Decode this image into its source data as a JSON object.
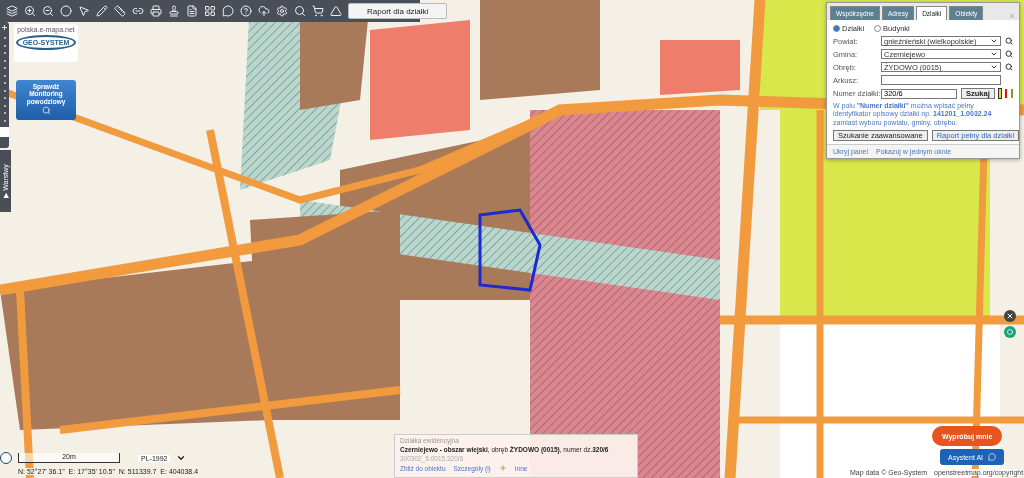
{
  "toolbar": {
    "report_button": "Raport dla działki"
  },
  "logo": {
    "site": "polska.e-mapa.net",
    "brand": "GEO-SYSTEM"
  },
  "flood_button": "Sprawdź Monitoring powodziowy",
  "zoom_slider": {
    "level": 0.1
  },
  "side_tab": {
    "icon": "▶",
    "label": "Warstwy"
  },
  "search_panel": {
    "tabs": [
      {
        "label": "Współrzędne",
        "selected": false
      },
      {
        "label": "Adresy",
        "selected": false
      },
      {
        "label": "Działki",
        "selected": true
      },
      {
        "label": "Obiekty",
        "selected": false
      }
    ],
    "radios": [
      {
        "label": "Działki",
        "selected": true
      },
      {
        "label": "Budynki",
        "selected": false
      }
    ],
    "fields": [
      {
        "label": "Powiat:",
        "kind": "select",
        "value": "gnieźnieński (wielkopolskie)"
      },
      {
        "label": "Gmina:",
        "kind": "select",
        "value": "Czerniejewo"
      },
      {
        "label": "Obręb:",
        "kind": "select",
        "value": "ŻYDOWO (0015)"
      },
      {
        "label": "Arkusz:",
        "kind": "text"
      }
    ],
    "number": {
      "label": "Numer działki:",
      "value": "320/6",
      "button": "Szukaj"
    },
    "swatches": [
      {
        "color": "#f2d21b",
        "selected": true
      },
      {
        "color": "#e01010",
        "selected": false
      },
      {
        "color": "#8a9a1a",
        "selected": false
      }
    ],
    "hint": "W polu **\"Numer działki\"** można wpisać pełny identyfikator opisowy działki np. **141201_1.0032.24** zamiast wyboru powiatu, gminy, obrębu.",
    "buttons": [
      "Szukanie zaawansowane",
      "Raport pełny dla działki"
    ],
    "footer_links": [
      "Ukryj panel",
      "Pokazuj w jednym oknie"
    ]
  },
  "info_popup": {
    "title": "Działka ewidencyjna",
    "description": "**Czerniejewo - obszar wiejski**, obręb **ŻYDOWO (0015)**, numer dz.**320/6**",
    "identifier": "300302_5.0015.320/6",
    "links": [
      "Zbliż do obiektu",
      "Szczegóły (i)",
      "Inne"
    ]
  },
  "status": {
    "scale": "20m",
    "projection": "PL-1992",
    "coordinates": "N: 52°27' 36.1\"  E: 17°35' 10.5\"  N: 511339.7  E: 404038.4",
    "credit": "Map data © Geo-System",
    "osm_link": "openstreetmap.org/copyright"
  },
  "try_button": "Wypróbuj mnie",
  "assistant_button": "Asystent AI"
}
